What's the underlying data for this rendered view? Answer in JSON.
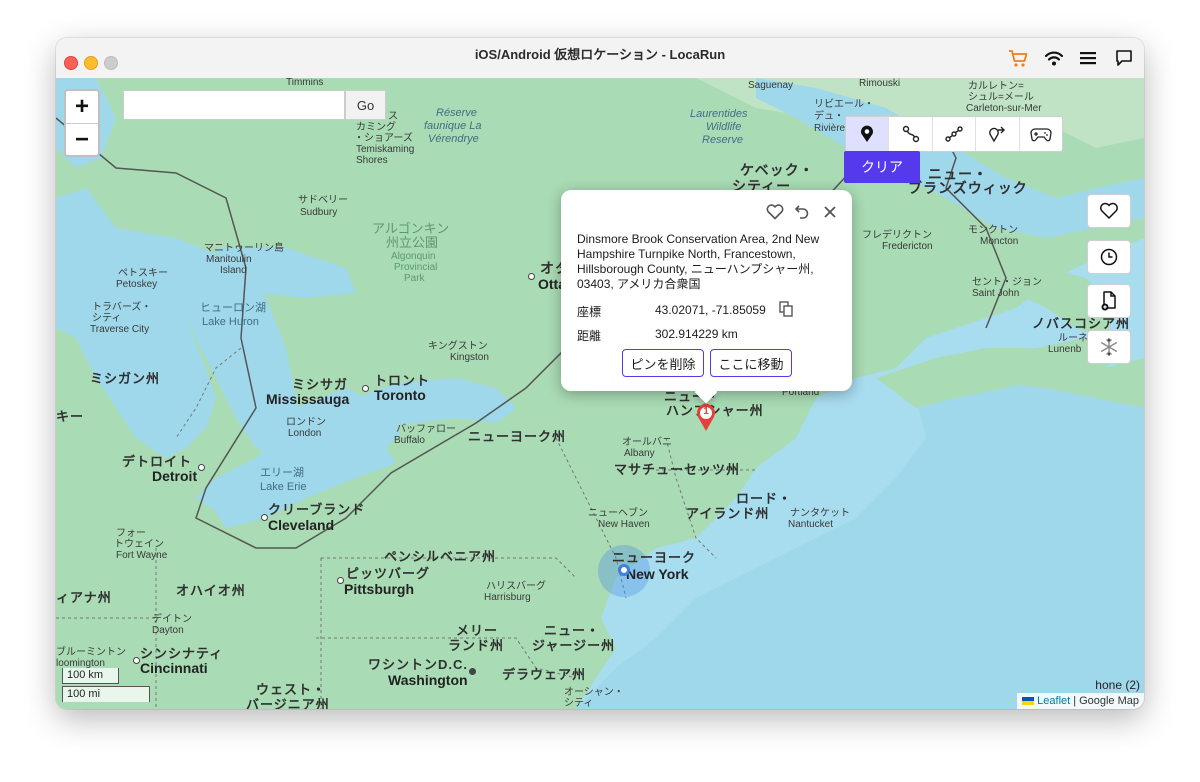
{
  "window": {
    "title": "iOS/Android 仮想ロケーション - LocaRun"
  },
  "toolbar": {
    "icons": [
      "cart-icon",
      "wifi-icon",
      "menu-icon",
      "chat-icon"
    ],
    "accent": "#5539ec"
  },
  "map": {
    "zoom_in": "+",
    "zoom_out": "−",
    "search": {
      "value": "",
      "placeholder": ""
    },
    "go_label": "Go",
    "mode_tools": [
      "teleport-pin-icon",
      "two-spot-route-icon",
      "multi-spot-route-icon",
      "jump-teleport-icon",
      "joystick-icon"
    ],
    "clear_label": "クリア",
    "side_tools": [
      "favorite-icon",
      "history-icon",
      "import-gpx-icon",
      "freeze-icon"
    ],
    "scale_km": "100 km",
    "scale_mi": "100 mi",
    "attribution": {
      "leaflet": "Leaflet",
      "sep": "|",
      "google": "Google Map"
    },
    "device": "hone (2)",
    "labels": {
      "timmins": "Timmins",
      "saguenay": "Saguenay",
      "rimouski": "Rimouski",
      "carleton_jp": "カルレトン=",
      "carleton_jp2": "シュル=メール",
      "carleton_en": "Carleton-sur-Mer",
      "riviere_jp": "リビエール・",
      "riviere_jp2": "デュ・",
      "riviere_en": "Rivière",
      "laurentides": "Laurentides",
      "wildlife": "Wildlife",
      "reserve": "Reserve",
      "laverendrye1": "Réserve",
      "laverendrye2": "faunique La",
      "laverendrye3": "Vérendrye",
      "temis_jp1": "テミス",
      "temis_jp2": "カミング",
      "temis_jp3": "・ショアーズ",
      "temis_en1": "Temiskaming",
      "temis_en2": "Shores",
      "quebec_jp": "ケベック・",
      "quebec_jp2": "シティー",
      "nb_jp": "ニュー・",
      "nb_jp2": "ブランズウィック",
      "sudbury_jp": "サドベリー",
      "sudbury_en": "Sudbury",
      "algonquin_jp1": "アルゴンキン",
      "algonquin_jp2": "州立公園",
      "algonquin_en1": "Algonquin",
      "algonquin_en2": "Provincial",
      "algonquin_en3": "Park",
      "ottawa_jp": "オタ",
      "ottawa_en": "Otta",
      "fredericton_jp": "フレデリクトン",
      "fredericton_en": "Fredericton",
      "moncton_jp": "モンクトン",
      "moncton_en": "Moncton",
      "saintjohn_jp": "セント・ジョン",
      "saintjohn_en": "Saint John",
      "ns_jp": "ノバスコシア州",
      "lunenburg_jp": "ルーネ",
      "lunenburg_en": "Lunenb",
      "manitoulin_jp": "マニトゥーリン島",
      "manitoulin_en1": "Manitoulin",
      "manitoulin_en2": "Island",
      "petoskey_jp": "ペトスキー",
      "petoskey_en": "Petoskey",
      "traverse_jp1": "トラバーズ・",
      "traverse_jp2": "シティ",
      "traverse_en": "Traverse City",
      "huron_jp": "ヒューロン湖",
      "huron_en": "Lake Huron",
      "kingston_jp": "キングストン",
      "kingston_en": "Kingston",
      "mi_jp": "ミシガン州",
      "mississauga_jp": "ミシサガ",
      "mississauga_en": "Mississauga",
      "toronto_jp": "トロント",
      "toronto_en": "Toronto",
      "nh_jp1": "ニュー・",
      "nh_jp2": "ハンプシャー州",
      "portland": "Portland",
      "wi_jp": "キー",
      "london_jp": "ロンドン",
      "london_en": "London",
      "buffalo_jp": "バッファロー",
      "buffalo_en": "Buffalo",
      "ny_state_jp": "ニューヨーク州",
      "albany_jp": "オールバニ",
      "albany_en": "Albany",
      "ma_jp": "マサチューセッツ州",
      "detroit_jp": "デトロイト",
      "detroit_en": "Detroit",
      "erie_jp": "エリー湖",
      "erie_en": "Lake Erie",
      "cleveland_jp": "クリーブランド",
      "cleveland_en": "Cleveland",
      "ri_jp1": "ロード・",
      "ri_jp2": "アイランド州",
      "nantucket_jp": "ナンタケット",
      "nantucket_en": "Nantucket",
      "newhaven_jp": "ニューヘブン",
      "newhaven_en": "New Haven",
      "fortwayne_jp1": "フォー",
      "fortwayne_jp2": "トウェイン",
      "fortwayne_en": "Fort Wayne",
      "pa_jp": "ペンシルベニア州",
      "nyc_jp": "ニューヨーク",
      "nyc_en": "New York",
      "pittsburgh_jp": "ピッツバーグ",
      "pittsburgh_en": "Pittsburgh",
      "harrisburg_jp": "ハリスバーグ",
      "harrisburg_en": "Harrisburg",
      "in_jp": "ィアナ州",
      "oh_jp": "オハイオ州",
      "dayton_jp": "デイトン",
      "dayton_en": "Dayton",
      "md_jp1": "メリー",
      "md_jp2": "ランド州",
      "nj_jp1": "ニュー・",
      "nj_jp2": "ジャージー州",
      "bloomington_jp": "ブルーミントン",
      "bloomington_en": "loomington",
      "cincinnati_jp": "シンシナティ",
      "cincinnati_en": "Cincinnati",
      "dc_jp": "ワシントンD.C.",
      "dc_en": "Washington",
      "de_jp": "デラウェア州",
      "oc_jp1": "オーシャン・",
      "oc_jp2": "シティ",
      "wv_jp1": "ウェスト・",
      "wv_jp2": "バージニア州"
    }
  },
  "popup": {
    "address": "Dinsmore Brook Conservation Area, 2nd New Hampshire Turnpike North, Francestown, Hillsborough County, ニューハンプシャー州, 03403, アメリカ合衆国",
    "coord_label": "座標",
    "coord_value": "43.02071, -71.85059",
    "dist_label": "距離",
    "dist_value": "302.914229 km",
    "delete_label": "ピンを削除",
    "move_label": "ここに移動"
  },
  "pin": {
    "number": "1"
  }
}
